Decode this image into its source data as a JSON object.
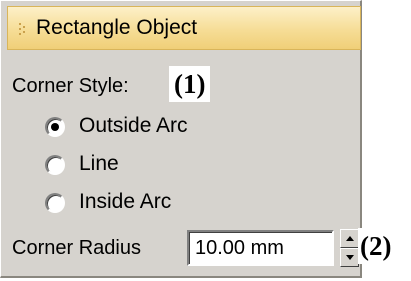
{
  "panel": {
    "title": "Rectangle Object",
    "corner_style_label": "Corner Style:",
    "corner_style_options": [
      {
        "label": "Outside Arc",
        "selected": true
      },
      {
        "label": "Line",
        "selected": false
      },
      {
        "label": "Inside Arc",
        "selected": false
      }
    ],
    "corner_radius_label": "Corner Radius",
    "corner_radius_value": "10.00 mm"
  },
  "annotations": {
    "corner_style_marker": "(1)",
    "corner_radius_marker": "(2)"
  },
  "icons": {
    "grip": "grip-dots-icon",
    "spin_up": "arrow-up-icon",
    "spin_down": "arrow-down-icon"
  },
  "colors": {
    "panel_bg": "#d6d3ce",
    "titlebar": "#f6dd96"
  }
}
